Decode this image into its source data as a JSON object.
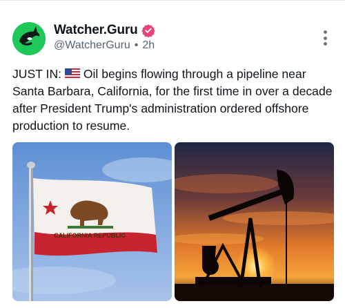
{
  "post": {
    "author_name": "Watcher.Guru",
    "handle": "@WatcherGuru",
    "separator": "•",
    "time": "2h",
    "text_prefix": "JUST IN:",
    "text_body": "Oil begins flowing through a pipeline near Santa Barbara, California, for the first time in over a decade after President Trump's administration ordered offshore production to resume.",
    "emoji_icon": "us-flag-icon"
  },
  "media": {
    "left": {
      "flag_text": "CALIFORNIA REPUBLIC",
      "icon": "california-flag"
    },
    "right": {
      "icon": "oil-pumpjack-sunset"
    }
  },
  "colors": {
    "brand": "#1fc85b",
    "verified": "#e5457a",
    "muted": "#536471"
  }
}
